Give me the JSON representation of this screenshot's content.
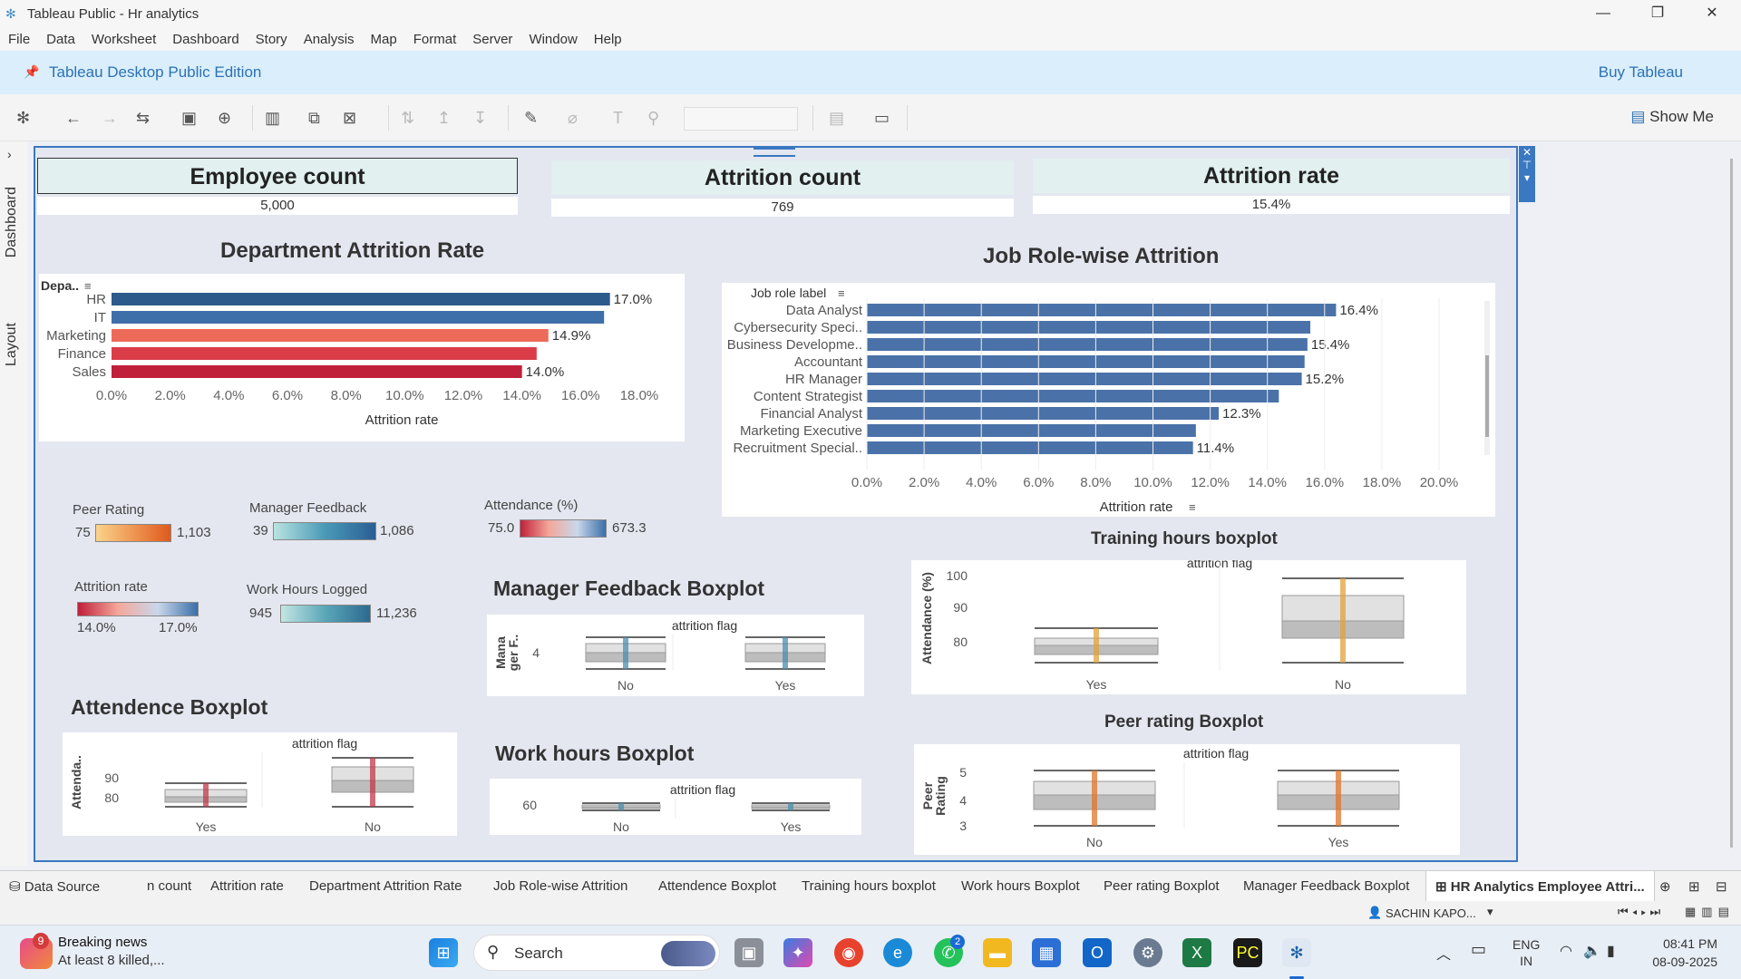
{
  "window": {
    "title": "Tableau Public - Hr analytics",
    "minimize": "—",
    "restore": "❐",
    "close": "✕"
  },
  "menu": [
    "File",
    "Data",
    "Worksheet",
    "Dashboard",
    "Story",
    "Analysis",
    "Map",
    "Format",
    "Server",
    "Window",
    "Help"
  ],
  "banner": {
    "edition": "Tableau Desktop Public Edition",
    "buy": "Buy Tableau"
  },
  "toolbar": {
    "show_me": "Show Me"
  },
  "side_tabs": {
    "dashboard": "Dashboard",
    "layout": "Layout"
  },
  "kpis": [
    {
      "title": "Employee count",
      "value": "5,000"
    },
    {
      "title": "Attrition count",
      "value": "769"
    },
    {
      "title": "Attrition rate",
      "value": "15.4%"
    }
  ],
  "titles": {
    "dept": "Department Attrition Rate",
    "job": "Job Role-wise Attrition",
    "training": "Training hours boxplot",
    "manager": "Manager Feedback Boxplot",
    "attendance": "Attendence Boxplot",
    "work": "Work hours Boxplot",
    "peer": "Peer rating Boxplot"
  },
  "legends": {
    "peer": {
      "title": "Peer Rating",
      "min": "75",
      "max": "1,103",
      "color_min": "#fbd38a",
      "color_max": "#e05a1c"
    },
    "manager": {
      "title": "Manager Feedback",
      "min": "39",
      "max": "1,086",
      "color_min": "#b9e4e0",
      "color_max": "#2a5e95"
    },
    "attendance": {
      "title": "Attendance (%)",
      "min": "75.0",
      "max": "673.3"
    },
    "attrition": {
      "title": "Attrition rate",
      "min": "14.0%",
      "max": "17.0%"
    },
    "work": {
      "title": "Work Hours Logged",
      "min": "945",
      "max": "11,236",
      "color_min": "#c3e6e2",
      "color_max": "#2c6a8f"
    }
  },
  "chart_data": [
    {
      "type": "bar",
      "title": "Department Attrition Rate",
      "dim_header": "Depa..",
      "xlabel": "Attrition rate",
      "xlim": [
        0,
        18
      ],
      "ticks": [
        "0.0%",
        "2.0%",
        "4.0%",
        "6.0%",
        "8.0%",
        "10.0%",
        "12.0%",
        "14.0%",
        "16.0%",
        "18.0%"
      ],
      "categories": [
        "HR",
        "IT",
        "Marketing",
        "Finance",
        "Sales"
      ],
      "values": [
        17.0,
        16.8,
        14.9,
        14.5,
        14.0
      ],
      "labels": [
        "17.0%",
        "",
        "14.9%",
        "",
        "14.0%"
      ],
      "colors": [
        "#2c5a8a",
        "#3f6fa8",
        "#ee6a58",
        "#da3c48",
        "#c0203a"
      ]
    },
    {
      "type": "bar",
      "title": "Job Role-wise Attrition",
      "dim_header": "Job role label",
      "xlabel": "Attrition rate",
      "xlim": [
        0,
        20
      ],
      "ticks": [
        "0.0%",
        "2.0%",
        "4.0%",
        "6.0%",
        "8.0%",
        "10.0%",
        "12.0%",
        "14.0%",
        "16.0%",
        "18.0%",
        "20.0%"
      ],
      "categories": [
        "Data Analyst",
        "Cybersecurity Speci..",
        "Business Developme..",
        "Accountant",
        "HR Manager",
        "Content Strategist",
        "Financial Analyst",
        "Marketing Executive",
        "Recruitment Special.."
      ],
      "values": [
        16.4,
        15.5,
        15.4,
        15.3,
        15.2,
        14.4,
        12.3,
        11.5,
        11.4
      ],
      "labels": [
        "16.4%",
        "",
        "15.4%",
        "",
        "15.2%",
        "",
        "12.3%",
        "",
        "11.4%"
      ],
      "color": "#4a72a8"
    },
    {
      "type": "boxplot",
      "title": "Training hours boxplot",
      "header": "attrition flag",
      "ylabel": "Attendance (%)",
      "yticks": [
        "100",
        "90",
        "80"
      ],
      "categories": [
        "Yes",
        "No"
      ],
      "color": "#e2a13a"
    },
    {
      "type": "boxplot",
      "title": "Manager Feedback Boxplot",
      "header": "attrition flag",
      "ylabel": "Mana ger F..",
      "yticks": [
        "4"
      ],
      "categories": [
        "No",
        "Yes"
      ],
      "color": "#4a8fb0"
    },
    {
      "type": "boxplot",
      "title": "Attendence Boxplot",
      "header": "attrition flag",
      "ylabel": "Attenda..",
      "yticks": [
        "90",
        "80"
      ],
      "categories": [
        "Yes",
        "No"
      ],
      "color": "#c0394a"
    },
    {
      "type": "boxplot",
      "title": "Work hours Boxplot",
      "header": "attrition flag",
      "ylabel": "",
      "yticks": [
        "60"
      ],
      "categories": [
        "No",
        "Yes"
      ],
      "color": "#4a8fa8"
    },
    {
      "type": "boxplot",
      "title": "Peer rating Boxplot",
      "header": "attrition flag",
      "ylabel": "Peer Rating",
      "yticks": [
        "5",
        "4",
        "3"
      ],
      "categories": [
        "No",
        "Yes"
      ],
      "color": "#e0762a"
    }
  ],
  "sheet_tabs": [
    "Data Source",
    "n count",
    "Attrition rate",
    "Department Attrition Rate",
    "Job Role-wise Attrition",
    "Attendence Boxplot",
    "Training hours boxplot",
    "Work hours Boxplot",
    "Peer rating Boxplot",
    "Manager Feedback Boxplot",
    "HR Analytics Employee Attri..."
  ],
  "status": {
    "user": "SACHIN KAPO..."
  },
  "taskbar": {
    "news_title": "Breaking news",
    "news_sub": "At least 8 killed,...",
    "news_badge": "9",
    "search": "Search",
    "whatsapp_badge": "2",
    "lang1": "ENG",
    "lang2": "IN",
    "time": "08:41 PM",
    "date": "08-09-2025"
  }
}
